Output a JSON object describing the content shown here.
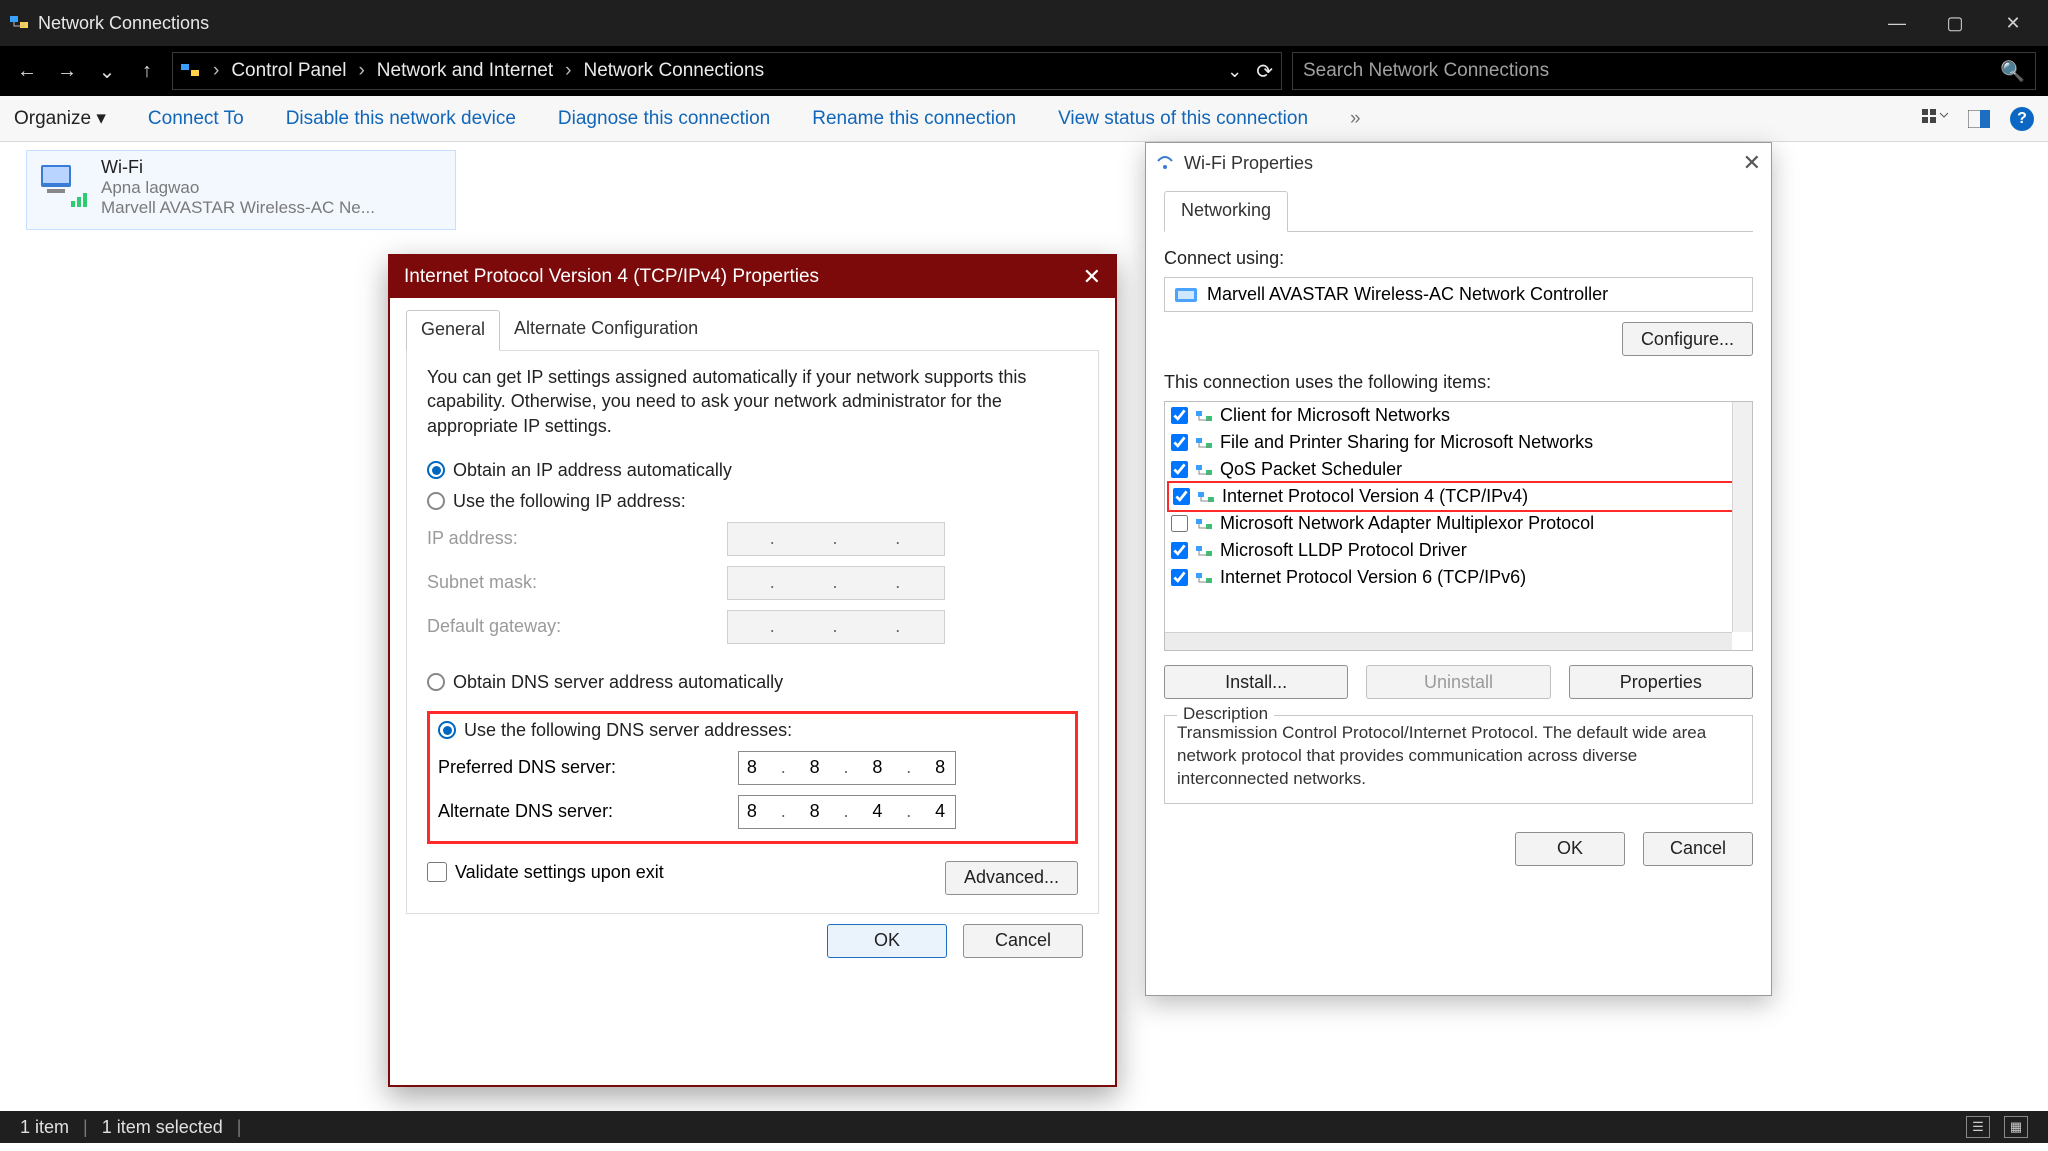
{
  "window": {
    "title": "Network Connections",
    "win_btn_min": "—",
    "win_btn_max": "▢",
    "win_btn_close": "✕"
  },
  "address": {
    "segs": [
      "Control Panel",
      "Network and Internet",
      "Network Connections"
    ]
  },
  "search": {
    "placeholder": "Search Network Connections"
  },
  "commands": {
    "organize": "Organize ▾",
    "items": [
      "Connect To",
      "Disable this network device",
      "Diagnose this connection",
      "Rename this connection",
      "View status of this connection"
    ],
    "more": "»"
  },
  "tile": {
    "name": "Wi-Fi",
    "ssid": "Apna lagwao",
    "adapter": "Marvell AVASTAR Wireless-AC Ne..."
  },
  "status": {
    "left1": "1 item",
    "left2": "1 item selected"
  },
  "wifi_dlg": {
    "title": "Wi-Fi Properties",
    "tab": "Networking",
    "connect_using_label": "Connect using:",
    "adapter": "Marvell AVASTAR Wireless-AC Network Controller",
    "configure": "Configure...",
    "items_label": "This connection uses the following items:",
    "items": [
      {
        "checked": true,
        "label": "Client for Microsoft Networks"
      },
      {
        "checked": true,
        "label": "File and Printer Sharing for Microsoft Networks"
      },
      {
        "checked": true,
        "label": "QoS Packet Scheduler"
      },
      {
        "checked": true,
        "label": "Internet Protocol Version 4 (TCP/IPv4)",
        "highlight": true
      },
      {
        "checked": false,
        "label": "Microsoft Network Adapter Multiplexor Protocol"
      },
      {
        "checked": true,
        "label": "Microsoft LLDP Protocol Driver"
      },
      {
        "checked": true,
        "label": "Internet Protocol Version 6 (TCP/IPv6)"
      }
    ],
    "install": "Install...",
    "uninstall": "Uninstall",
    "properties": "Properties",
    "desc_legend": "Description",
    "desc_text": "Transmission Control Protocol/Internet Protocol. The default wide area network protocol that provides communication across diverse interconnected networks.",
    "ok": "OK",
    "cancel": "Cancel"
  },
  "ipv4_dlg": {
    "title": "Internet Protocol Version 4 (TCP/IPv4) Properties",
    "tab_general": "General",
    "tab_alt": "Alternate Configuration",
    "intro": "You can get IP settings assigned automatically if your network supports this capability. Otherwise, you need to ask your network administrator for the appropriate IP settings.",
    "r_obtain_ip": "Obtain an IP address automatically",
    "r_use_ip": "Use the following IP address:",
    "lab_ip": "IP address:",
    "lab_mask": "Subnet mask:",
    "lab_gw": "Default gateway:",
    "r_obtain_dns": "Obtain DNS server address automatically",
    "r_use_dns": "Use the following DNS server addresses:",
    "lab_pdns": "Preferred DNS server:",
    "lab_adns": "Alternate DNS server:",
    "pdns": [
      "8",
      "8",
      "8",
      "8"
    ],
    "adns": [
      "8",
      "8",
      "4",
      "4"
    ],
    "validate": "Validate settings upon exit",
    "advanced": "Advanced...",
    "ok": "OK",
    "cancel": "Cancel"
  }
}
